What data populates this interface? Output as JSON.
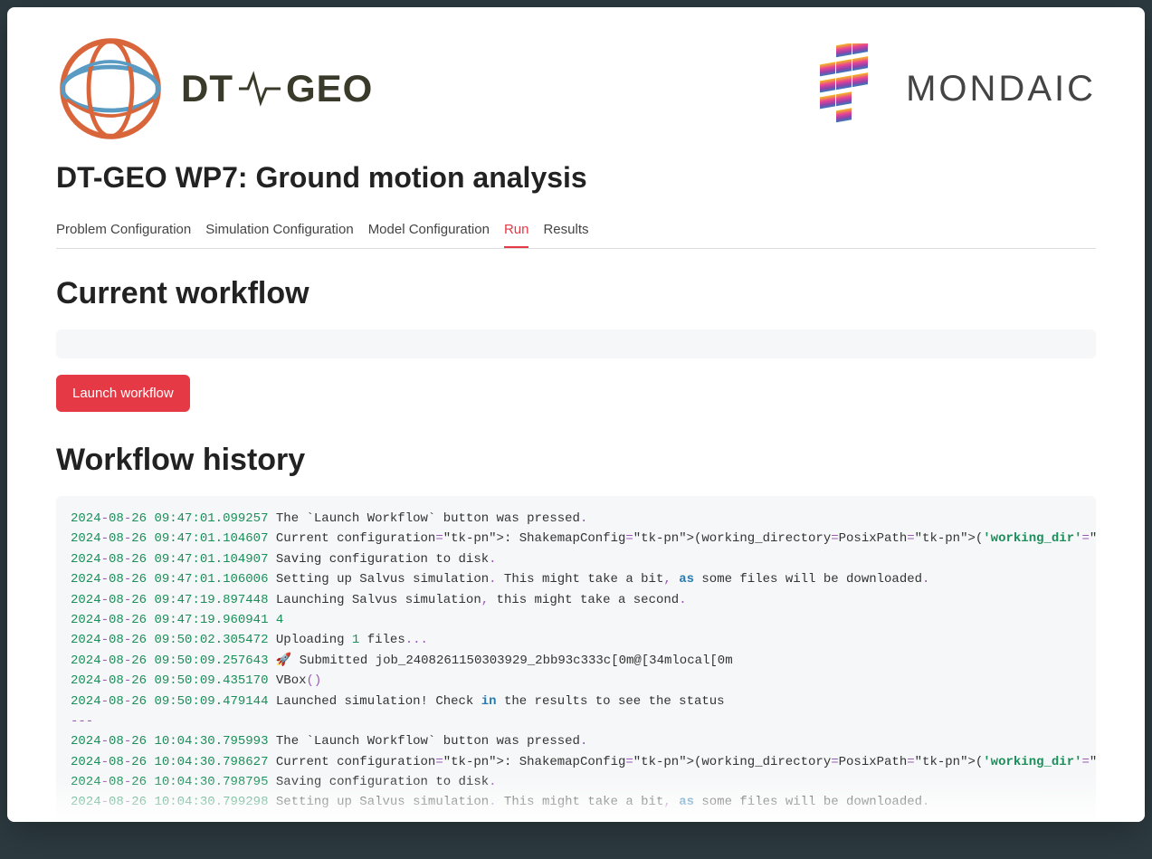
{
  "header": {
    "logo_left_text": "DT-~-GEO",
    "logo_right_text": "MONDAIC",
    "page_title": "DT-GEO WP7: Ground motion analysis"
  },
  "tabs": [
    {
      "label": "Problem Configuration",
      "active": false
    },
    {
      "label": "Simulation Configuration",
      "active": false
    },
    {
      "label": "Model Configuration",
      "active": false
    },
    {
      "label": "Run",
      "active": true
    },
    {
      "label": "Results",
      "active": false
    }
  ],
  "sections": {
    "current_workflow_heading": "Current workflow",
    "workflow_history_heading": "Workflow history"
  },
  "buttons": {
    "launch_label": "Launch workflow"
  },
  "log_lines": [
    {
      "ts": "2024-08-26 09:47:01.099257",
      "body": "The `Launch Workflow` button was pressed.",
      "type": "plain"
    },
    {
      "ts": "2024-08-26 09:47:01.104607",
      "body": "Current configuration: ShakemapConfig(working_directory=PosixPath('working_dir'), event_filename=PosixPath('wo",
      "type": "config"
    },
    {
      "ts": "2024-08-26 09:47:01.104907",
      "body": "Saving configuration to disk.",
      "type": "plain"
    },
    {
      "ts": "2024-08-26 09:47:01.106006",
      "body": "Setting up Salvus simulation. This might take a bit, as some files will be downloaded.",
      "type": "as"
    },
    {
      "ts": "2024-08-26 09:47:19.897448",
      "body": "Launching Salvus simulation, this might take a second.",
      "type": "plain"
    },
    {
      "ts": "2024-08-26 09:47:19.960941",
      "body": "4",
      "type": "num"
    },
    {
      "ts": "2024-08-26 09:50:02.305472",
      "body": "Uploading 1 files...",
      "type": "upload"
    },
    {
      "ts": "2024-08-26 09:50:09.257643",
      "body": "🚀  Submitted job_2408261150303929_2bb93c333c[0m@[34mlocal[0m",
      "type": "plain"
    },
    {
      "ts": "2024-08-26 09:50:09.435170",
      "body": "VBox()",
      "type": "vbox"
    },
    {
      "ts": "2024-08-26 09:50:09.479144",
      "body": "Launched simulation! Check in the results to see the status",
      "type": "in"
    },
    {
      "sep": "---"
    },
    {
      "ts": "2024-08-26 10:04:30.795993",
      "body": "The `Launch Workflow` button was pressed.",
      "type": "plain"
    },
    {
      "ts": "2024-08-26 10:04:30.798627",
      "body": "Current configuration: ShakemapConfig(working_directory=PosixPath('working_dir'), event_filename=PosixPath('wo",
      "type": "config"
    },
    {
      "ts": "2024-08-26 10:04:30.798795",
      "body": "Saving configuration to disk.",
      "type": "plain"
    },
    {
      "ts": "2024-08-26 10:04:30.799298",
      "body": "Setting up Salvus simulation. This might take a bit, as some files will be downloaded.",
      "type": "as"
    }
  ]
}
